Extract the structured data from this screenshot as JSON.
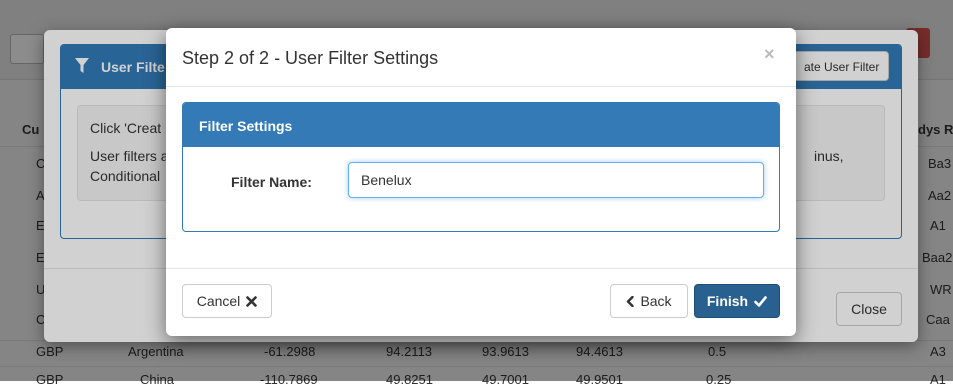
{
  "background": {
    "header_cells": [
      "Cu",
      "dys R"
    ],
    "left_col": [
      "C",
      "A",
      "E",
      "E",
      "U",
      "C"
    ],
    "right_col": [
      "Ba3",
      "Aa2",
      "A1",
      "Baa2",
      "WR",
      "Caa"
    ],
    "rows": [
      {
        "currency": "GBP",
        "country": "Argentina",
        "v1": "-61.2988",
        "v2": "94.2113",
        "v3": "93.9613",
        "v4": "94.4613",
        "v5": "0.5",
        "rating": "A3"
      },
      {
        "currency": "GBP",
        "country": "China",
        "v1": "-110.7869",
        "v2": "49.8251",
        "v3": "49.7001",
        "v4": "49.9501",
        "v5": "0.25",
        "rating": "A1"
      }
    ]
  },
  "modal_user_filter": {
    "title": "User Filte",
    "create_button_label": "ate User Filter",
    "instructions_line1": "Click 'Creat",
    "instructions_line2": "User filters a",
    "instructions_line3": "Conditional",
    "instructions_right": "inus,",
    "close_label": "Close"
  },
  "modal_step": {
    "title": "Step 2 of 2 - User Filter Settings",
    "close_symbol": "×",
    "panel_title": "Filter Settings",
    "filter_name_label": "Filter Name:",
    "filter_name_value": "Benelux",
    "cancel_label": "Cancel",
    "back_label": "Back",
    "finish_label": "Finish"
  },
  "colors": {
    "primary": "#337ab7",
    "primary_dark": "#286090",
    "danger": "#d9534f"
  }
}
